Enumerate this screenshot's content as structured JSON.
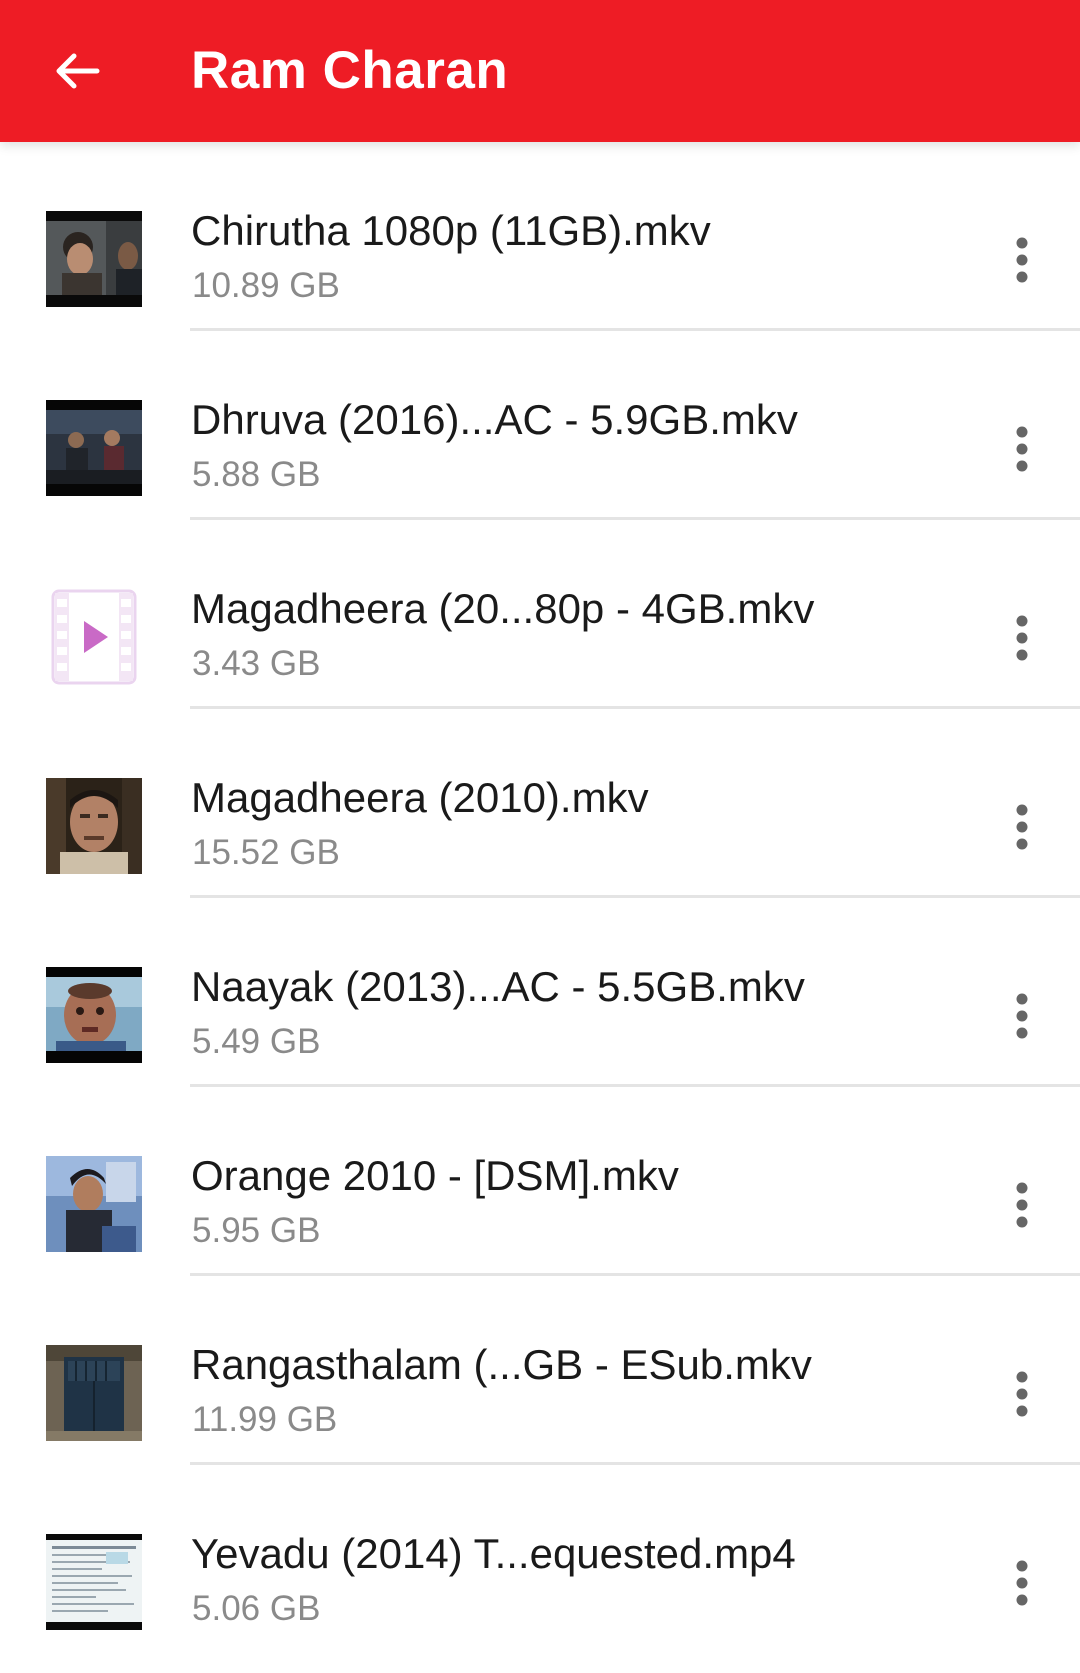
{
  "appbar": {
    "title": "Ram Charan",
    "back_icon": "arrow-left-icon",
    "color": "#ee1c25"
  },
  "files": [
    {
      "name": "Chirutha 1080p (11GB).mkv",
      "size": "10.89 GB",
      "thumbnail": "video-frame"
    },
    {
      "name": "Dhruva (2016)...AC - 5.9GB.mkv",
      "size": "5.88 GB",
      "thumbnail": "video-frame"
    },
    {
      "name": "Magadheera (20...80p - 4GB.mkv",
      "size": "3.43 GB",
      "thumbnail": "generic-video-file-icon"
    },
    {
      "name": "Magadheera (2010).mkv",
      "size": "15.52 GB",
      "thumbnail": "video-frame"
    },
    {
      "name": "Naayak (2013)...AC - 5.5GB.mkv",
      "size": "5.49 GB",
      "thumbnail": "video-frame"
    },
    {
      "name": "Orange 2010 - [DSM].mkv",
      "size": "5.95 GB",
      "thumbnail": "video-frame"
    },
    {
      "name": "Rangasthalam (...GB - ESub.mkv",
      "size": "11.99 GB",
      "thumbnail": "video-frame"
    },
    {
      "name": "Yevadu (2014) T...equested.mp4",
      "size": "5.06 GB",
      "thumbnail": "video-frame"
    }
  ],
  "row_menu_icon": "more-vertical-icon"
}
